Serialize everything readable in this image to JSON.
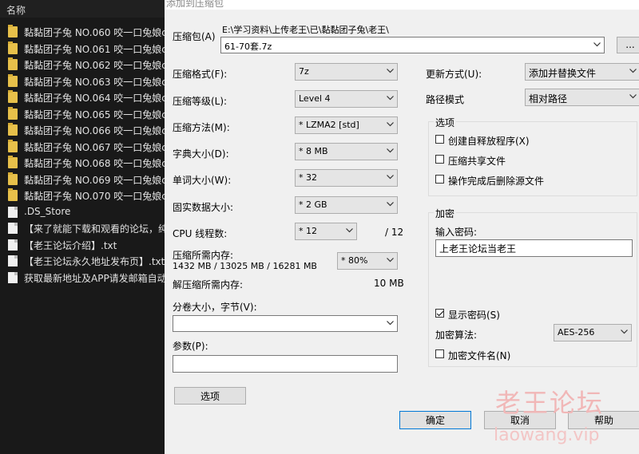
{
  "explorer": {
    "header": "名称",
    "items": [
      {
        "name": "黏黏团子兔 NO.060 咬一口兔娘c",
        "type": "folder"
      },
      {
        "name": "黏黏团子兔 NO.061 咬一口兔娘c",
        "type": "folder"
      },
      {
        "name": "黏黏团子兔 NO.062 咬一口兔娘c",
        "type": "folder"
      },
      {
        "name": "黏黏团子兔 NO.063 咬一口兔娘c",
        "type": "folder"
      },
      {
        "name": "黏黏团子兔 NO.064 咬一口兔娘c",
        "type": "folder"
      },
      {
        "name": "黏黏团子兔 NO.065 咬一口兔娘c",
        "type": "folder"
      },
      {
        "name": "黏黏团子兔 NO.066 咬一口兔娘c",
        "type": "folder"
      },
      {
        "name": "黏黏团子兔 NO.067 咬一口兔娘c",
        "type": "folder"
      },
      {
        "name": "黏黏团子兔 NO.068 咬一口兔娘c",
        "type": "folder"
      },
      {
        "name": "黏黏团子兔 NO.069 咬一口兔娘c",
        "type": "folder"
      },
      {
        "name": "黏黏团子兔 NO.070 咬一口兔娘c",
        "type": "folder"
      },
      {
        "name": ".DS_Store",
        "type": "file"
      },
      {
        "name": "【来了就能下载和观看的论坛，纯",
        "type": "file"
      },
      {
        "name": "【老王论坛介绍】.txt",
        "type": "file"
      },
      {
        "name": "【老王论坛永久地址发布页】.txt",
        "type": "file"
      },
      {
        "name": "获取最新地址及APP请发邮箱自动",
        "type": "file"
      }
    ]
  },
  "dialog": {
    "title": "添加到压缩包",
    "archive_label": "压缩包(A)",
    "archive_path": "E:\\学习资料\\上传老王\\已\\黏黏团子兔\\老王\\",
    "archive_name": "61-70套.7z",
    "browse_label": "...",
    "format_label": "压缩格式(F):",
    "format_value": "7z",
    "level_label": "压缩等级(L):",
    "level_value": "Level 4",
    "method_label": "压缩方法(M):",
    "method_value": "* LZMA2 [std]",
    "dict_label": "字典大小(D):",
    "dict_value": "* 8 MB",
    "word_label": "单词大小(W):",
    "word_value": "* 32",
    "solid_label": "固实数据大小:",
    "solid_value": "* 2 GB",
    "cpu_label": "CPU 线程数:",
    "cpu_value": "* 12",
    "cpu_total": "/ 12",
    "mem_label": "压缩所需内存:",
    "mem_values": "1432 MB / 13025 MB / 16281 MB",
    "mem_percent": "* 80%",
    "decomp_label": "解压缩所需内存:",
    "decomp_value": "10 MB",
    "split_label": "分卷大小，字节(V):",
    "split_value": "",
    "params_label": "参数(P):",
    "params_value": "",
    "options_button": "选项",
    "update_label": "更新方式(U):",
    "update_value": "添加并替换文件",
    "path_label": "路径模式",
    "path_value": "相对路径",
    "options_group": "选项",
    "opt_sfx": "创建自释放程序(X)",
    "opt_shared": "压缩共享文件",
    "opt_delete": "操作完成后删除源文件",
    "encrypt_group": "加密",
    "password_label": "输入密码:",
    "password_value": "上老王论坛当老王",
    "show_password": "显示密码(S)",
    "enc_method_label": "加密算法:",
    "enc_method_value": "AES-256",
    "enc_names": "加密文件名(N)",
    "ok": "确定",
    "cancel": "取消",
    "help": "帮助"
  },
  "watermark": {
    "line1": "老王论坛",
    "line2": "laowang.vip"
  }
}
